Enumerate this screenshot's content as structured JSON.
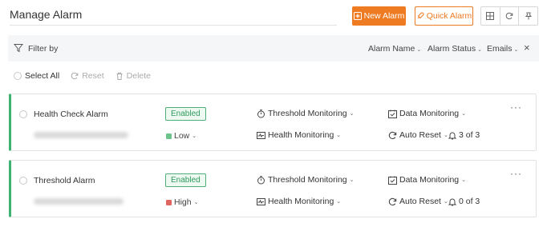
{
  "header": {
    "title": "Manage Alarm",
    "new_alarm_label": "New Alarm",
    "quick_alarm_label": "Quick Alarm"
  },
  "filter": {
    "label": "Filter by",
    "alarm_name": "Alarm Name",
    "alarm_status": "Alarm Status",
    "emails": "Emails"
  },
  "bulk": {
    "select_all": "Select All",
    "reset": "Reset",
    "delete": "Delete"
  },
  "alarms": [
    {
      "name": "Health Check Alarm",
      "status": "Enabled",
      "severity": "Low",
      "severity_color": "#6cc38c",
      "monitor_type": "Threshold Monitoring",
      "health": "Health Monitoring",
      "data": "Data Monitoring",
      "reset": "Auto Reset",
      "count": "3 of 3"
    },
    {
      "name": "Threshold Alarm",
      "status": "Enabled",
      "severity": "High",
      "severity_color": "#e0675f",
      "monitor_type": "Threshold Monitoring",
      "health": "Health Monitoring",
      "data": "Data Monitoring",
      "reset": "Auto Reset",
      "count": "0 of 3"
    }
  ],
  "colors": {
    "accent": "#ee7a22",
    "card_border": "#3cb371"
  }
}
